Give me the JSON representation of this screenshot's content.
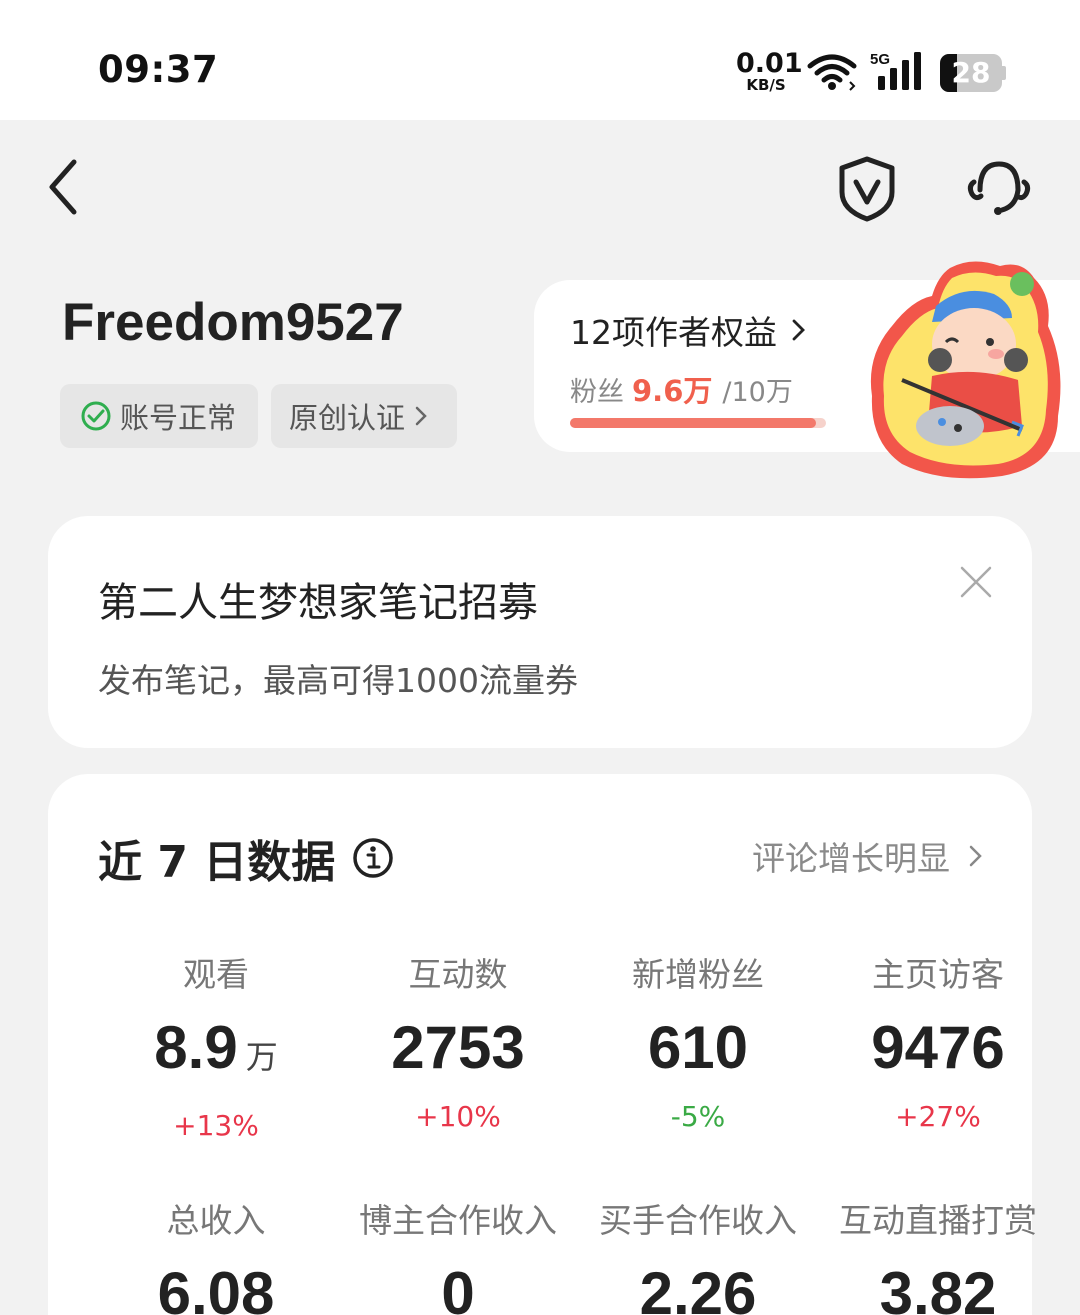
{
  "status_bar": {
    "time": "09:37",
    "net_speed_value": "0.01",
    "net_speed_unit": "KB/S",
    "signal_label": "5G",
    "battery_level": "28"
  },
  "profile": {
    "username": "Freedom9527",
    "account_status": "账号正常",
    "original_cert": "原创认证"
  },
  "rights": {
    "title": "12项作者权益",
    "fans_label": "粉丝",
    "fans_current": "9.6万",
    "fans_target": "/10万",
    "progress_fraction": 0.96
  },
  "promo": {
    "title": "第二人生梦想家笔记招募",
    "description": "发布笔记，最高可得1000流量券"
  },
  "stats": {
    "title": "近 7 日数据",
    "hint": "评论增长明显",
    "row1": [
      {
        "label": "观看",
        "value": "8.9",
        "unit": "万",
        "change": "+13%",
        "trend": "up"
      },
      {
        "label": "互动数",
        "value": "2753",
        "unit": "",
        "change": "+10%",
        "trend": "up"
      },
      {
        "label": "新增粉丝",
        "value": "610",
        "unit": "",
        "change": "-5%",
        "trend": "down"
      },
      {
        "label": "主页访客",
        "value": "9476",
        "unit": "",
        "change": "+27%",
        "trend": "up"
      }
    ],
    "row2": [
      {
        "label": "总收入",
        "value": "6.08"
      },
      {
        "label": "博主合作收入",
        "value": "0"
      },
      {
        "label": "买手合作收入",
        "value": "2.26"
      },
      {
        "label": "互动直播打赏",
        "value": "3.82"
      }
    ]
  },
  "colors": {
    "increase": "#e8364a",
    "decrease": "#3aaa45",
    "accent": "#f0604d"
  }
}
